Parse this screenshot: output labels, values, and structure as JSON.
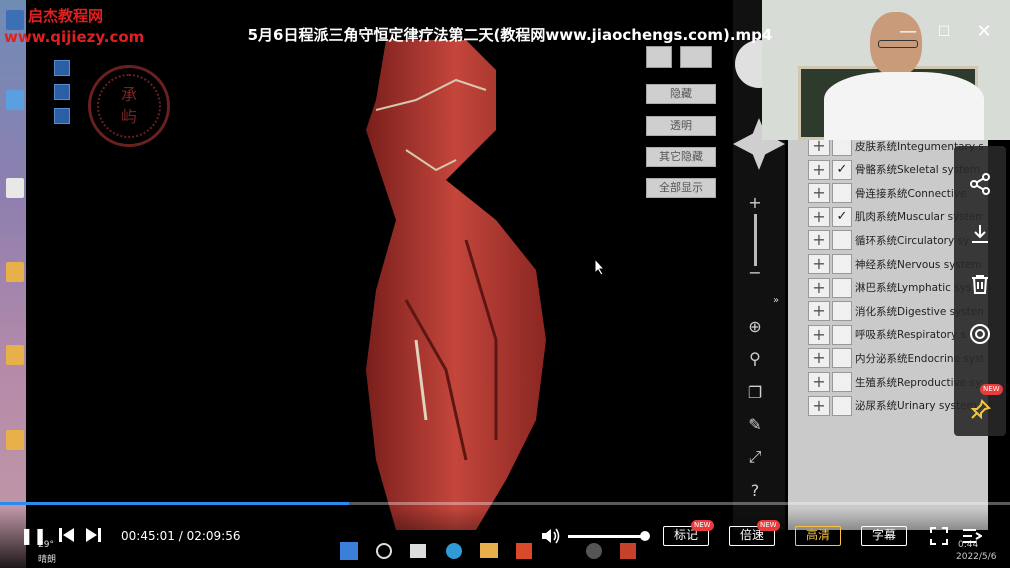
{
  "watermark": {
    "top": "启杰教程网",
    "url": "www.qijiezy.com"
  },
  "video": {
    "title": "5月6日程派三角守恒定律疗法第二天(教程网www.jiaochengs.com).mp4",
    "time_current": "00:45:01",
    "time_separator": " / ",
    "time_total": "02:09:56",
    "progress_fraction": 0.346
  },
  "seal": {
    "char1": "承",
    "char2": "屿"
  },
  "app_buttons": [
    "隐藏",
    "透明",
    "其它隐藏",
    "全部显示"
  ],
  "systems": [
    {
      "label": "皮肤系统Integumentary s",
      "checked": false
    },
    {
      "label": "骨骼系统Skeletal system",
      "checked": true
    },
    {
      "label": "骨连接系统Connective",
      "checked": false
    },
    {
      "label": "肌肉系统Muscular system",
      "checked": true
    },
    {
      "label": "循环系统Circulatory sy",
      "checked": false
    },
    {
      "label": "神经系统Nervous system",
      "checked": false
    },
    {
      "label": "淋巴系统Lymphatic sys",
      "checked": false
    },
    {
      "label": "消化系统Digestive system",
      "checked": false
    },
    {
      "label": "呼吸系统Respiratory s",
      "checked": false
    },
    {
      "label": "内分泌系统Endocrine syst",
      "checked": false
    },
    {
      "label": "生殖系统Reproductive sys",
      "checked": false
    },
    {
      "label": "泌尿系统Urinary system",
      "checked": false
    }
  ],
  "player_buttons": {
    "mark": "标记",
    "speed": "倍速",
    "quality": "高清",
    "subtitle": "字幕",
    "new_tag": "NEW"
  },
  "side_new_tag": "NEW",
  "colors": {
    "accent": "#2b8cf0",
    "quality": "#f5c542",
    "watermark": "#e02020"
  },
  "taskbar": {
    "weather_temp": "29°",
    "weather_text": "晴朗",
    "clock_time": "0:44",
    "clock_date": "2022/5/6"
  }
}
